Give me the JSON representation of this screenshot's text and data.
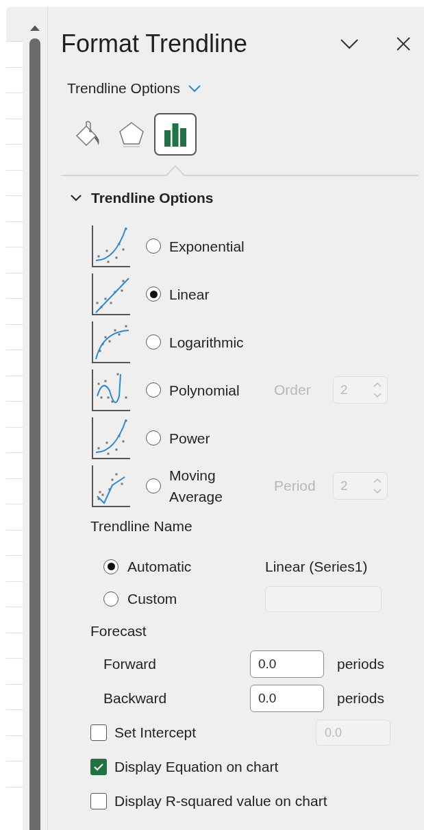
{
  "pane": {
    "title": "Format Trendline"
  },
  "options_menu": {
    "label": "Trendline Options"
  },
  "tabs": [
    {
      "kind": "fill",
      "selected": false
    },
    {
      "kind": "effects",
      "selected": false
    },
    {
      "kind": "options",
      "selected": true
    }
  ],
  "section": {
    "title": "Trendline Options",
    "expanded": true
  },
  "types": [
    {
      "kind": "exponential",
      "label": "Exponential",
      "selected": false
    },
    {
      "kind": "linear",
      "label": "Linear",
      "selected": true
    },
    {
      "kind": "logarithmic",
      "label": "Logarithmic",
      "selected": false
    },
    {
      "kind": "polynomial",
      "label": "Polynomial",
      "selected": false,
      "param": {
        "label": "Order",
        "value": "2",
        "disabled": true
      }
    },
    {
      "kind": "power",
      "label": "Power",
      "selected": false
    },
    {
      "kind": "moving_average",
      "label": "Moving Average",
      "selected": false,
      "param": {
        "label": "Period",
        "value": "2",
        "disabled": true
      }
    }
  ],
  "name_group": {
    "title": "Trendline Name",
    "options": [
      {
        "label": "Automatic",
        "selected": true,
        "value": "Linear (Series1)"
      },
      {
        "label": "Custom",
        "selected": false
      }
    ]
  },
  "forecast": {
    "title": "Forecast",
    "rows": [
      {
        "label": "Forward",
        "value": "0.0",
        "unit": "periods"
      },
      {
        "label": "Backward",
        "value": "0.0",
        "unit": "periods"
      }
    ]
  },
  "checks": [
    {
      "label": "Set Intercept",
      "checked": false,
      "value": "0.0",
      "value_disabled": true
    },
    {
      "label": "Display Equation on chart",
      "checked": true
    },
    {
      "label": "Display R-squared value on chart",
      "checked": false
    }
  ]
}
